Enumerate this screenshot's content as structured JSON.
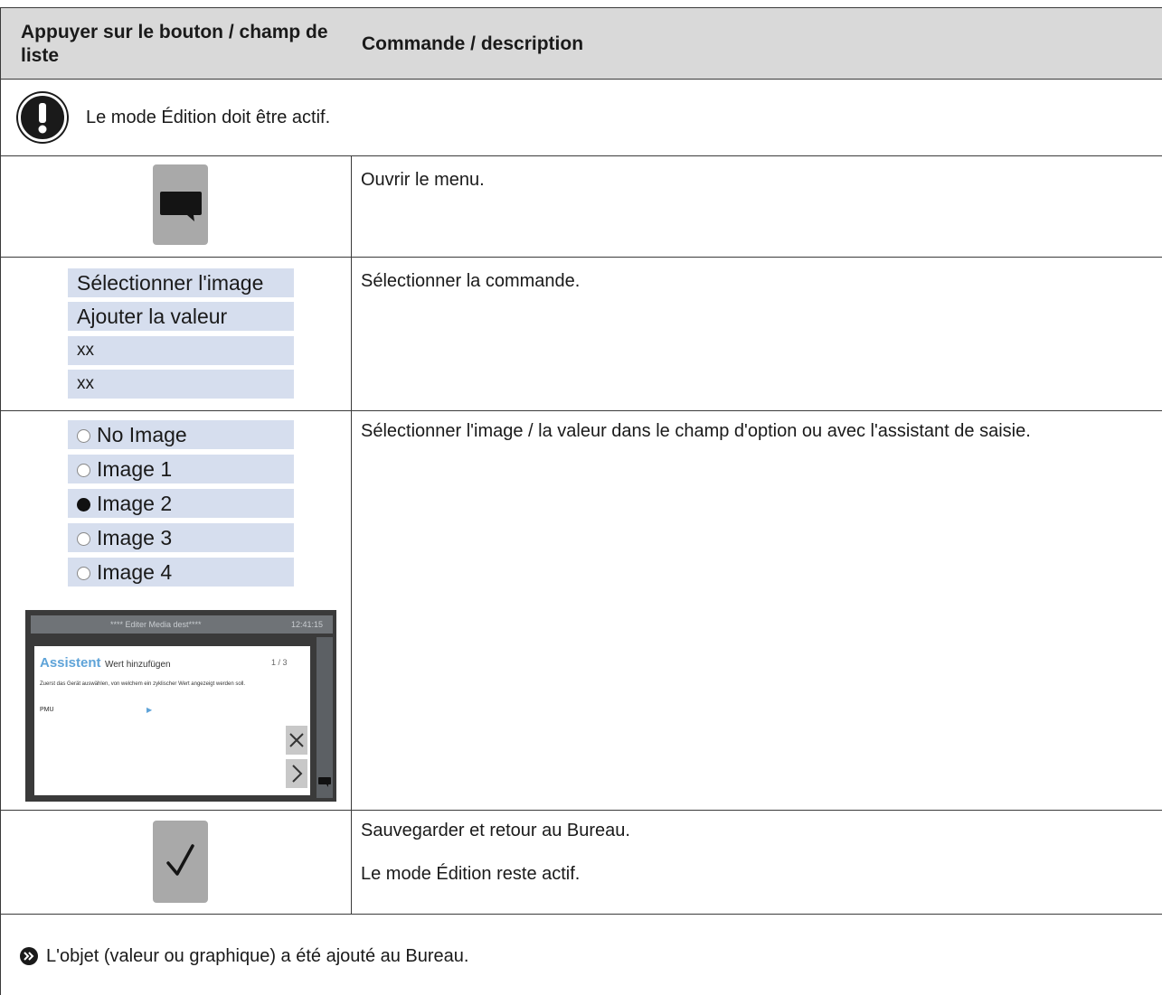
{
  "header": {
    "col1": "Appuyer sur le bouton / champ de liste",
    "col2": "Commande / description"
  },
  "notice": {
    "icon": "exclamation-icon",
    "text": "Le mode Édition doit être actif."
  },
  "rows": [
    {
      "description": "Ouvrir le menu.",
      "icon": "speech-bubble-icon"
    },
    {
      "description": "Sélectionner la commande.",
      "menu_items": [
        "Sélectionner l'image",
        "Ajouter la valeur",
        "xx",
        "xx"
      ]
    },
    {
      "description": "Sélectionner l'image / la valeur dans le champ d'option ou avec l'assistant de saisie.",
      "options": [
        {
          "label": "No Image",
          "selected": false
        },
        {
          "label": "Image 1",
          "selected": false
        },
        {
          "label": "Image 2",
          "selected": true
        },
        {
          "label": "Image 3",
          "selected": false
        },
        {
          "label": "Image 4",
          "selected": false
        }
      ],
      "assistant": {
        "topbar_title": "**** Editer Media dest****",
        "topbar_time": "12:41:15",
        "title_accent": "Assistent",
        "title_rest": "Wert hinzufügen",
        "step": "1 / 3",
        "body": "Zuerst das Gerät auswählen, von welchem ein zyklischer Wert angezeigt werden soll.",
        "field_label": "PMU",
        "field_value": "▶",
        "close_icon": "close-icon",
        "next_icon": "chevron-right-icon"
      }
    },
    {
      "description": "Sauvegarder et retour au Bureau.",
      "description2": "Le mode Édition reste actif.",
      "icon": "checkmark-icon"
    }
  ],
  "result": {
    "icon": "double-chevron-circle-icon",
    "text": "L'objet (valeur ou graphique) a été ajouté au Bureau."
  }
}
